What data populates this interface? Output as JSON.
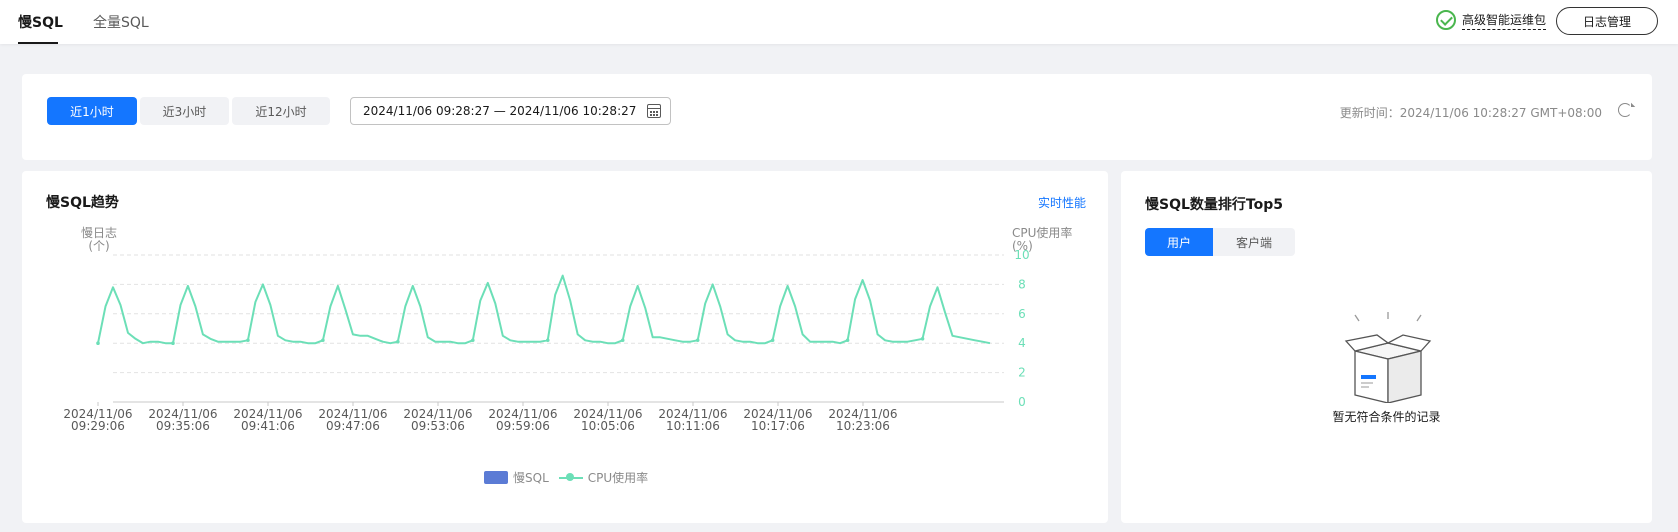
{
  "tabs": [
    {
      "label": "慢SQL",
      "active": true
    },
    {
      "label": "全量SQL",
      "active": false
    }
  ],
  "header": {
    "addon_label": "高级智能运维包",
    "log_button": "日志管理"
  },
  "filter": {
    "ranges": [
      "近1小时",
      "近3小时",
      "近12小时"
    ],
    "selected_range": "近1小时",
    "date_range": "2024/11/06 09:28:27 — 2024/11/06 10:28:27",
    "update_time": "更新时间：2024/11/06 10:28:27 GMT+08:00"
  },
  "trend": {
    "title": "慢SQL趋势",
    "link": "实时性能",
    "y_left_label_1": "慢日志",
    "y_left_label_2": "(个)",
    "y_right_label_1": "CPU使用率",
    "y_right_label_2": "(%)",
    "legend_bar": "慢SQL",
    "legend_line": "CPU使用率"
  },
  "top5": {
    "title": "慢SQL数量排行Top5",
    "tabs": [
      "用户",
      "客户端"
    ],
    "selected_tab": "用户",
    "empty_text": "暂无符合条件的记录"
  },
  "colors": {
    "accent": "#1476ff",
    "cpu_line": "#6cdfb7",
    "slow_sql": "#5b7bd5"
  },
  "chart_data": {
    "type": "line",
    "title": "慢SQL趋势",
    "ylabel_left": "慢日志 (个)",
    "ylabel_right": "CPU使用率 (%)",
    "y_right_ticks": [
      0,
      2,
      4,
      6,
      8,
      10
    ],
    "ylim_right": [
      0,
      10
    ],
    "x_tick_labels": [
      [
        "2024/11/06",
        "09:29:06"
      ],
      [
        "2024/11/06",
        "09:35:06"
      ],
      [
        "2024/11/06",
        "09:41:06"
      ],
      [
        "2024/11/06",
        "09:47:06"
      ],
      [
        "2024/11/06",
        "09:53:06"
      ],
      [
        "2024/11/06",
        "09:59:06"
      ],
      [
        "2024/11/06",
        "10:05:06"
      ],
      [
        "2024/11/06",
        "10:11:06"
      ],
      [
        "2024/11/06",
        "10:17:06"
      ],
      [
        "2024/11/06",
        "10:23:06"
      ]
    ],
    "x_range": [
      "2024/11/06 09:29:06",
      "2024/11/06 10:28:06"
    ],
    "grid": true,
    "legend_placement": "bottom-center",
    "series": [
      {
        "name": "慢SQL",
        "axis": "left",
        "values": []
      },
      {
        "name": "CPU使用率",
        "axis": "right",
        "values": [
          4.0,
          6.5,
          7.8,
          6.6,
          4.7,
          4.3,
          4.0,
          4.1,
          4.1,
          4.0,
          4.0,
          6.6,
          7.9,
          6.5,
          4.6,
          4.3,
          4.1,
          4.1,
          4.1,
          4.1,
          4.2,
          6.8,
          8.0,
          6.6,
          4.5,
          4.2,
          4.1,
          4.1,
          4.0,
          4.0,
          4.2,
          6.5,
          7.9,
          6.3,
          4.6,
          4.5,
          4.5,
          4.3,
          4.1,
          4.0,
          4.1,
          6.5,
          7.9,
          6.5,
          4.4,
          4.1,
          4.1,
          4.1,
          4.0,
          4.0,
          4.2,
          6.9,
          8.1,
          6.7,
          4.5,
          4.2,
          4.1,
          4.1,
          4.1,
          4.1,
          4.2,
          7.3,
          8.6,
          6.9,
          4.6,
          4.2,
          4.1,
          4.1,
          4.0,
          4.0,
          4.2,
          6.5,
          7.9,
          6.4,
          4.4,
          4.4,
          4.3,
          4.2,
          4.1,
          4.1,
          4.2,
          6.7,
          8.0,
          6.5,
          4.6,
          4.2,
          4.1,
          4.1,
          4.0,
          4.0,
          4.2,
          6.5,
          7.9,
          6.5,
          4.6,
          4.1,
          4.1,
          4.1,
          4.1,
          4.0,
          4.2,
          7.0,
          8.3,
          6.9,
          4.6,
          4.2,
          4.1,
          4.1,
          4.1,
          4.2,
          4.3,
          6.5,
          7.8,
          6.1,
          4.5,
          4.4,
          4.3,
          4.2,
          4.1,
          4.0
        ]
      }
    ]
  }
}
